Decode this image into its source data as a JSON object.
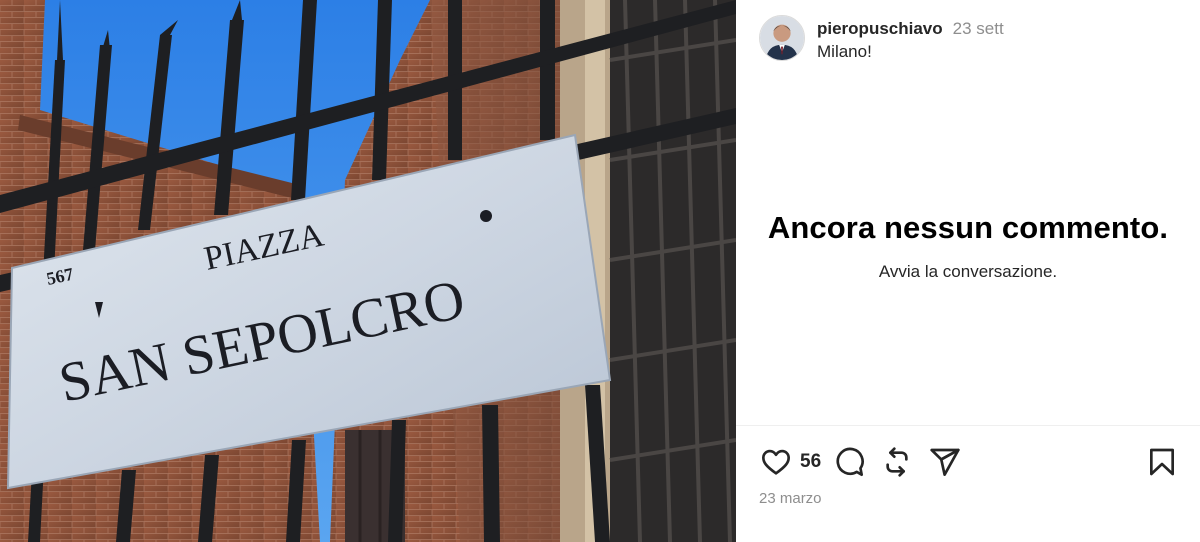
{
  "post": {
    "image": {
      "alt_sign_number": "567",
      "sign_line1": "PIAZZA",
      "sign_line2": "SAN SEPOLCRO"
    },
    "author": {
      "username": "pieropuschiavo",
      "avatar": "avatar-photo"
    },
    "time_ago": "23 sett",
    "caption": "Milano!",
    "comments_empty": {
      "title": "Ancora nessun commento.",
      "subtitle": "Avvia la conversazione."
    },
    "actions": {
      "like_icon": "heart-icon",
      "like_count": "56",
      "comment_icon": "comment-icon",
      "repost_icon": "repost-icon",
      "share_icon": "share-icon",
      "save_icon": "bookmark-icon"
    },
    "date": "23 marzo"
  },
  "colors": {
    "text_primary": "#262626",
    "text_secondary": "#8e8e8e",
    "divider": "#efefef"
  }
}
